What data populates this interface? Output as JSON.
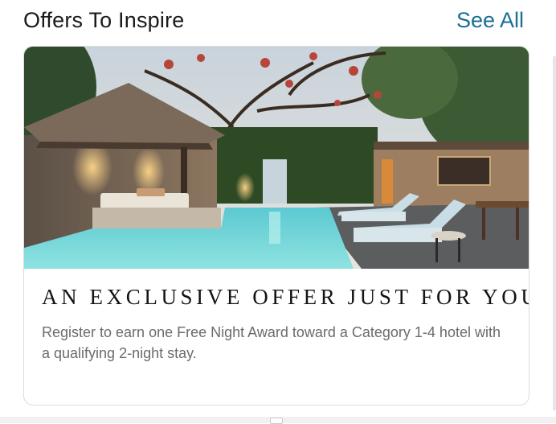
{
  "section": {
    "title": "Offers To Inspire",
    "see_all_label": "See All"
  },
  "offer_card": {
    "heading": "AN EXCLUSIVE OFFER JUST FOR YOU",
    "description": "Register to earn one Free Night Award toward a Category 1-4 hotel with a qualifying 2-night stay.",
    "image_subject": "resort-pool-villa-photo"
  },
  "colors": {
    "link": "#1a6f95",
    "heading": "#141414",
    "body_text": "#6b6b6b",
    "pool_water": "#6fd3d6"
  }
}
